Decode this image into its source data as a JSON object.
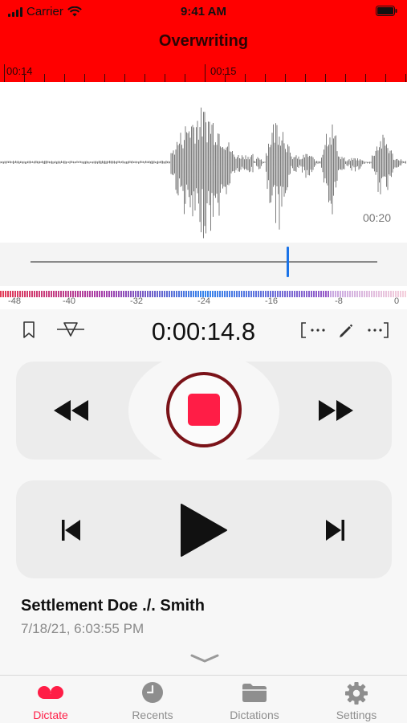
{
  "status_bar": {
    "carrier": "Carrier",
    "time": "9:41 AM"
  },
  "header": {
    "title": "Overwriting",
    "timeline_labels": [
      "00:14",
      "00:15"
    ]
  },
  "waveform": {
    "time_label": "00:20"
  },
  "scrubber": {
    "position_fraction": 0.74
  },
  "level_meter": {
    "labels": [
      "-48",
      "-40",
      "-32",
      "-24",
      "-16",
      "-8",
      "0"
    ]
  },
  "toolbar": {
    "elapsed_time": "0:00:14.8",
    "icons": [
      "bookmark-icon",
      "marker-icon",
      "insert-start-icon",
      "edit-icon",
      "insert-end-icon"
    ]
  },
  "transport": {
    "rewind": "rewind-icon",
    "record_stop": "stop-icon",
    "fast_forward": "fast-forward-icon",
    "skip_back": "skip-back-icon",
    "play": "play-icon",
    "skip_forward": "skip-forward-icon"
  },
  "recording": {
    "title": "Settlement Doe ./. Smith",
    "date": "7/18/21, 6:03:55 PM"
  },
  "tabs": [
    {
      "label": "Dictate",
      "icon": "dictate-icon",
      "active": true
    },
    {
      "label": "Recents",
      "icon": "clock-icon",
      "active": false
    },
    {
      "label": "Dictations",
      "icon": "folder-icon",
      "active": false
    },
    {
      "label": "Settings",
      "icon": "gear-icon",
      "active": false
    }
  ],
  "colors": {
    "header": "#ff0000",
    "accent": "#ff1d46",
    "record_ring": "#7a1218",
    "scrub_cursor": "#1a73e8"
  }
}
